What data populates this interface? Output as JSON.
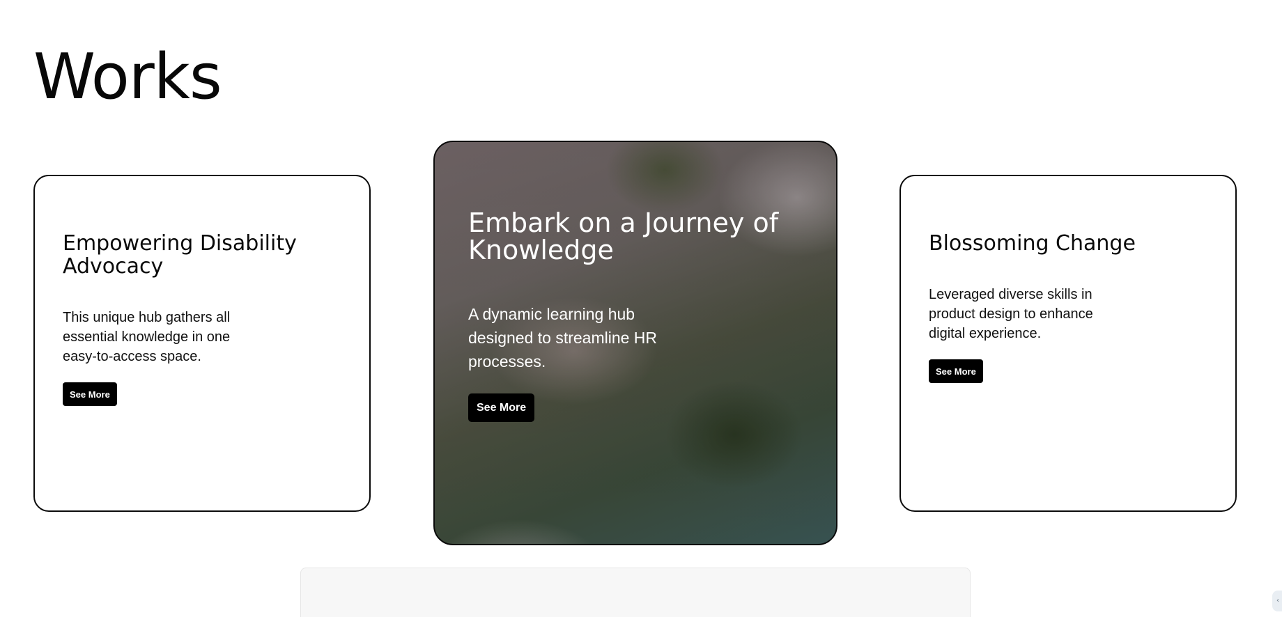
{
  "page": {
    "title": "Works"
  },
  "cards": [
    {
      "title": "Empowering Disability Advocacy",
      "description": "This unique hub gathers all essential knowledge in one easy-to-access space.",
      "button_label": "See More"
    },
    {
      "title": "Embark on a Journey of Knowledge",
      "description": "A dynamic learning hub designed to streamline HR processes.",
      "button_label": "See More",
      "background": "aerial-forest-mist-image"
    },
    {
      "title": "Blossoming Change",
      "description": "Leveraged diverse skills in product design to enhance digital experience.",
      "button_label": "See More"
    }
  ],
  "edge_tab": {
    "icon": "chevron-left-icon",
    "glyph": "‹"
  },
  "colors": {
    "background": "#ffffff",
    "text": "#0a0a0a",
    "button_bg": "#000000",
    "button_text": "#ffffff",
    "card_border": "#0a0a0a"
  }
}
